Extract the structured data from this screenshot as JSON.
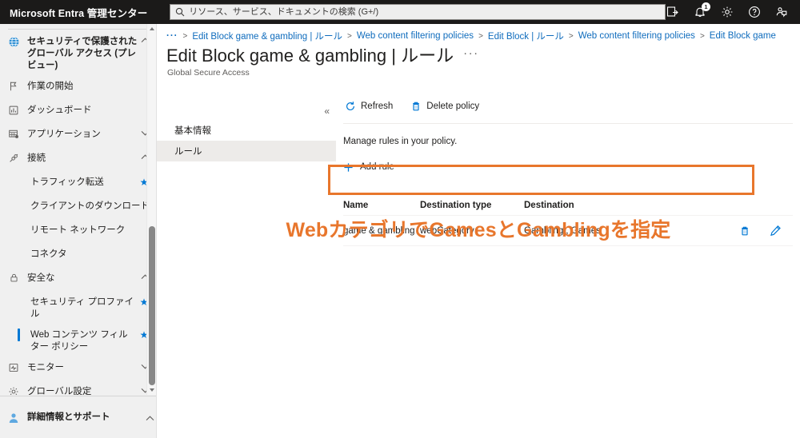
{
  "topbar": {
    "brand": "Microsoft Entra 管理センター",
    "search": {
      "placeholder": "リソース、サービス、ドキュメントの検索 (G+/)",
      "value": "",
      "icon": "search-icon"
    },
    "icons": [
      {
        "name": "directory-switch-icon",
        "glyph": "directory"
      },
      {
        "name": "notifications-bell-icon",
        "glyph": "bell",
        "badge": "1"
      },
      {
        "name": "settings-gear-icon",
        "glyph": "gear"
      },
      {
        "name": "help-question-icon",
        "glyph": "question"
      },
      {
        "name": "feedback-icon",
        "glyph": "feedback"
      }
    ]
  },
  "sidebar": {
    "items": [
      {
        "label": "セキュリティで保護された グローバル アクセス (プレビュー)",
        "icon": "globe-icon",
        "chevron": "up",
        "bold": true,
        "sub": false,
        "star": false,
        "selected": false
      },
      {
        "label": "作業の開始",
        "icon": "flag-icon",
        "chevron": "",
        "bold": false,
        "sub": false,
        "star": false,
        "selected": false
      },
      {
        "label": "ダッシュボード",
        "icon": "dashboard-icon",
        "chevron": "",
        "bold": false,
        "sub": false,
        "star": false,
        "selected": false
      },
      {
        "label": "アプリケーション",
        "icon": "applications-icon",
        "chevron": "down",
        "bold": false,
        "sub": false,
        "star": false,
        "selected": false
      },
      {
        "label": "接続",
        "icon": "connect-icon",
        "chevron": "up",
        "bold": false,
        "sub": false,
        "star": false,
        "selected": false
      },
      {
        "label": "トラフィック転送",
        "icon": "",
        "chevron": "",
        "bold": false,
        "sub": true,
        "star": true,
        "selected": false
      },
      {
        "label": "クライアントのダウンロード",
        "icon": "",
        "chevron": "",
        "bold": false,
        "sub": true,
        "star": false,
        "selected": false
      },
      {
        "label": "リモート ネットワーク",
        "icon": "",
        "chevron": "",
        "bold": false,
        "sub": true,
        "star": false,
        "selected": false
      },
      {
        "label": "コネクタ",
        "icon": "",
        "chevron": "",
        "bold": false,
        "sub": true,
        "star": false,
        "selected": false
      },
      {
        "label": "安全な",
        "icon": "lock-icon",
        "chevron": "up",
        "bold": false,
        "sub": false,
        "star": false,
        "selected": false
      },
      {
        "label": "セキュリティ プロファイル",
        "icon": "",
        "chevron": "",
        "bold": false,
        "sub": true,
        "star": true,
        "selected": false
      },
      {
        "label": "Web コンテンツ フィルター ポリシー",
        "icon": "",
        "chevron": "",
        "bold": false,
        "sub": true,
        "star": true,
        "selected": true
      },
      {
        "label": "モニター",
        "icon": "monitor-icon",
        "chevron": "down",
        "bold": false,
        "sub": false,
        "star": false,
        "selected": false
      },
      {
        "label": "グローバル設定",
        "icon": "gear-icon",
        "chevron": "down",
        "bold": false,
        "sub": false,
        "star": false,
        "selected": false
      }
    ],
    "bottom_item": {
      "label": "詳細情報とサポート",
      "icon": "support-person-icon",
      "chevron": "up"
    }
  },
  "breadcrumb": {
    "leading": "···",
    "items": [
      "Edit Block game & gambling | ルール",
      "Web content filtering policies",
      "Edit Block | ルール",
      "Web content filtering policies",
      "Edit Block game"
    ]
  },
  "page": {
    "title": "Edit Block game & gambling | ルール",
    "title_menu": "···",
    "subtitle": "Global Secure Access",
    "collapse_icon": "«"
  },
  "subnav": {
    "items": [
      {
        "label": "基本情報",
        "active": false
      },
      {
        "label": "ルール",
        "active": true
      }
    ]
  },
  "toolbar": {
    "refresh_label": "Refresh",
    "refresh_icon": "refresh-icon",
    "delete_label": "Delete policy",
    "delete_icon": "trash-icon"
  },
  "content": {
    "hint": "Manage rules in your policy.",
    "add_rule_label": "Add rule",
    "add_rule_icon": "plus-icon"
  },
  "table": {
    "columns": [
      "Name",
      "Destination type",
      "Destination",
      ""
    ],
    "rows": [
      {
        "name": "game & gambling",
        "destination_type": "webCategory",
        "destination": "Gambling , Games",
        "delete_icon": "trash-icon",
        "edit_icon": "pencil-icon"
      }
    ]
  },
  "annotation": {
    "text": "Webカテゴリで",
    "text2": "Games",
    "text3": "と",
    "text4": "Gambling",
    "text5": "を指定",
    "color": "#E8762C"
  },
  "colors": {
    "accent_blue": "#0078d4",
    "link_blue": "#0f6cbd",
    "annotation_orange": "#E8762C",
    "topbar_black": "#1b1a19",
    "nav_bg": "#f0f0f0"
  }
}
